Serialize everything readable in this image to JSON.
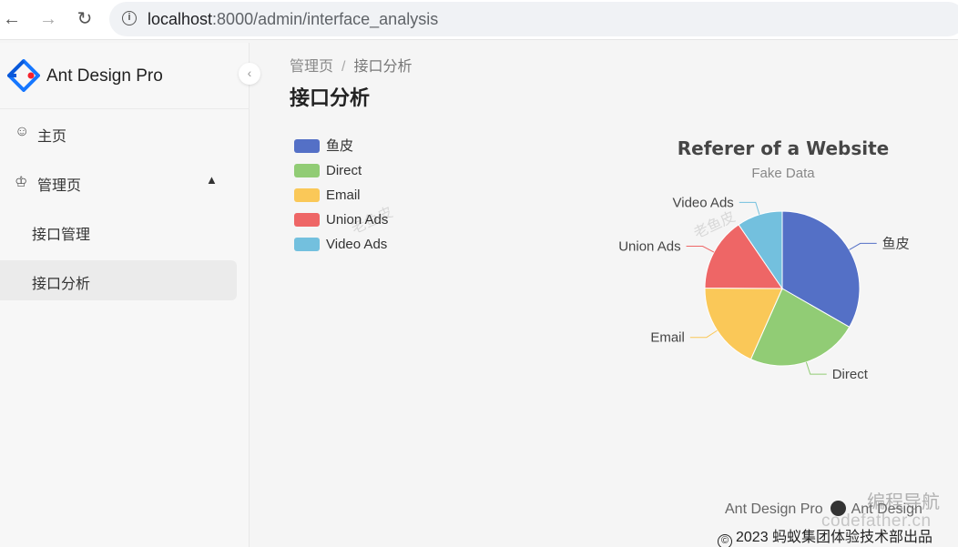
{
  "browser": {
    "url_host": "localhost",
    "url_path": ":8000/admin/interface_analysis",
    "icons": [
      "back-arrow-icon",
      "forward-arrow-icon",
      "reload-icon",
      "info-icon"
    ]
  },
  "sidebar": {
    "app_name": "Ant Design Pro",
    "collapse_icon": "‹",
    "items": [
      {
        "label": "主页",
        "icon": "smile-icon"
      },
      {
        "label": "管理页",
        "icon": "crown-icon",
        "expanded": true
      }
    ],
    "subitems": [
      {
        "label": "接口管理",
        "active": false
      },
      {
        "label": "接口分析",
        "active": true
      }
    ]
  },
  "header": {
    "breadcrumb": [
      "管理页",
      "接口分析"
    ],
    "breadcrumb_sep": "/",
    "title": "接口分析"
  },
  "chart_data": {
    "type": "pie",
    "title": "Referer of a Website",
    "subtitle": "Fake Data",
    "legend_position": "top-left",
    "categories": [
      "鱼皮",
      "Direct",
      "Email",
      "Union Ads",
      "Video Ads"
    ],
    "values": [
      1048,
      735,
      580,
      484,
      300
    ],
    "colors": [
      "#5470c6",
      "#91cc75",
      "#fac858",
      "#ee6666",
      "#73c0de"
    ],
    "watermark": "老鱼皮"
  },
  "footer": {
    "link1": "Ant Design Pro",
    "link2": "Ant Design",
    "copyright": "2023 蚂蚁集团体验技术部出品",
    "copyright_symbol": "©"
  },
  "overlay": {
    "nav_watermark": "编程导航",
    "site_watermark": "codefather.cn"
  }
}
